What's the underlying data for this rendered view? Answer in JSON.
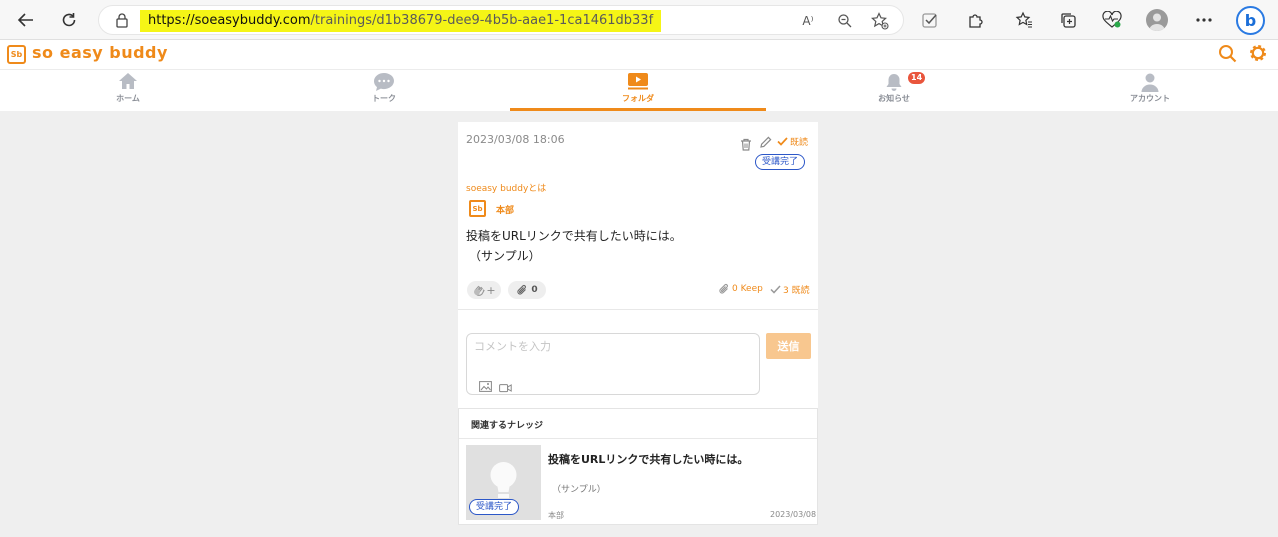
{
  "browser": {
    "url_host": "https://soeasybuddy.com",
    "url_path": "/trainings/d1b38679-dee9-4b5b-aae1-1ca1461db33f",
    "read_aloud_label": "A⁾"
  },
  "app": {
    "logo_mark": "Sb",
    "logo_text": "so easy buddy",
    "accent_color": "#ef8a1a"
  },
  "tabs": [
    {
      "label": "ホーム",
      "icon": "home-icon"
    },
    {
      "label": "トーク",
      "icon": "chat-icon"
    },
    {
      "label": "フォルダ",
      "icon": "folder-play-icon",
      "active": true
    },
    {
      "label": "お知らせ",
      "icon": "bell-icon",
      "badge": "14"
    },
    {
      "label": "アカウント",
      "icon": "user-icon"
    }
  ],
  "post": {
    "date": "2023/03/08 18:06",
    "read_label": "既読",
    "status": "受講完了",
    "category": "soeasy buddyとは",
    "author_mark": "Sb",
    "author": "本部",
    "body_line1": "投稿をURLリンクで共有したい時には。",
    "body_line2": "（サンプル）",
    "attachments": "0",
    "keep_label": "0 Keep",
    "read_count": "3 既読"
  },
  "comment": {
    "placeholder": "コメントを入力",
    "send_label": "送信"
  },
  "related": {
    "title": "関連するナレッジ",
    "item": {
      "status": "受講完了",
      "heading": "投稿をURLリンクで共有したい時には。",
      "sub": "（サンプル）",
      "author": "本部",
      "date": "2023/03/08"
    }
  }
}
